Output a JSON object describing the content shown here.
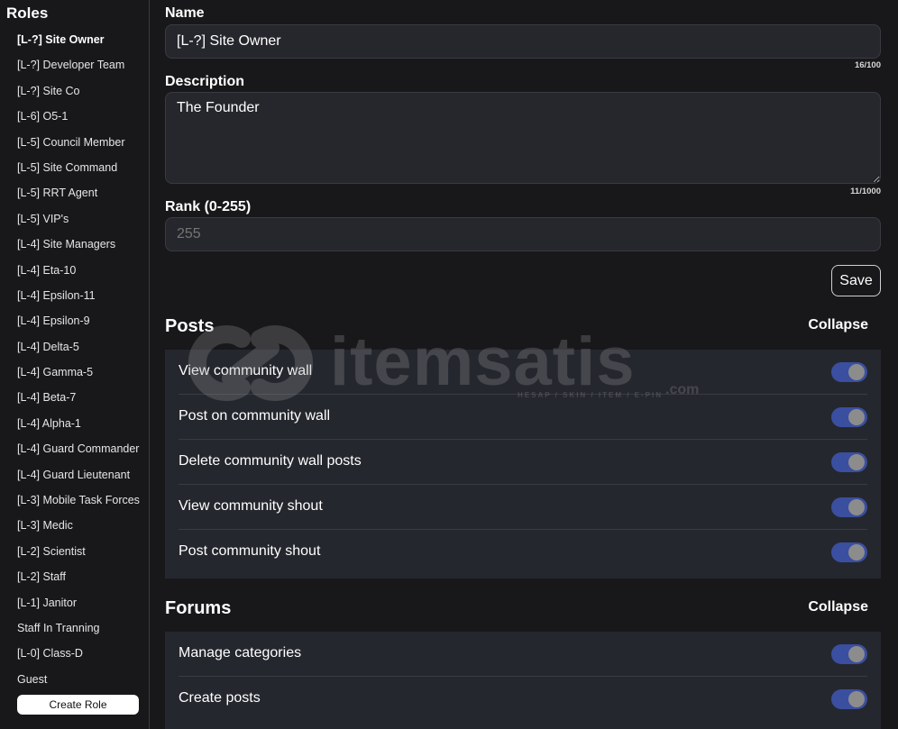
{
  "sidebar": {
    "title": "Roles",
    "roles": [
      "[L-?] Site Owner",
      "[L-?] Developer Team",
      "[L-?] Site Co",
      "[L-6] O5-1",
      "[L-5] Council Member",
      "[L-5] Site Command",
      "[L-5] RRT Agent",
      "[L-5] VIP's",
      "[L-4] Site Managers",
      "[L-4] Eta-10",
      "[L-4] Epsilon-11",
      "[L-4] Epsilon-9",
      "[L-4] Delta-5",
      "[L-4] Gamma-5",
      "[L-4] Beta-7",
      "[L-4] Alpha-1",
      "[L-4] Guard Commander",
      "[L-4] Guard Lieutenant",
      "[L-3] Mobile Task Forces",
      "[L-3] Medic",
      "[L-2] Scientist",
      "[L-2] Staff",
      "[L-1] Janitor",
      "Staff In Tranning",
      "[L-0] Class-D",
      "Guest"
    ],
    "active_index": 0,
    "create_role_label": "Create Role"
  },
  "form": {
    "name_label": "Name",
    "name_value": "[L-?] Site Owner",
    "name_counter": "16/100",
    "description_label": "Description",
    "description_value": "The Founder",
    "description_counter": "11/1000",
    "rank_label": "Rank (0-255)",
    "rank_value": "255",
    "save_label": "Save"
  },
  "sections": [
    {
      "title": "Posts",
      "collapse_label": "Collapse",
      "permissions": [
        {
          "label": "View community wall",
          "enabled": true
        },
        {
          "label": "Post on community wall",
          "enabled": true
        },
        {
          "label": "Delete community wall posts",
          "enabled": true
        },
        {
          "label": "View community shout",
          "enabled": true
        },
        {
          "label": "Post community shout",
          "enabled": true
        }
      ]
    },
    {
      "title": "Forums",
      "collapse_label": "Collapse",
      "permissions": [
        {
          "label": "Manage categories",
          "enabled": true
        },
        {
          "label": "Create posts",
          "enabled": true
        }
      ]
    }
  ],
  "watermark": {
    "brand": "itemsatis",
    "tagline": "HESAP / SKIN / ITEM / E-PIN",
    "suffix": ".com"
  },
  "colors": {
    "background": "#18181b",
    "panel": "#25272e",
    "toggle_on": "#3a4fa0"
  }
}
